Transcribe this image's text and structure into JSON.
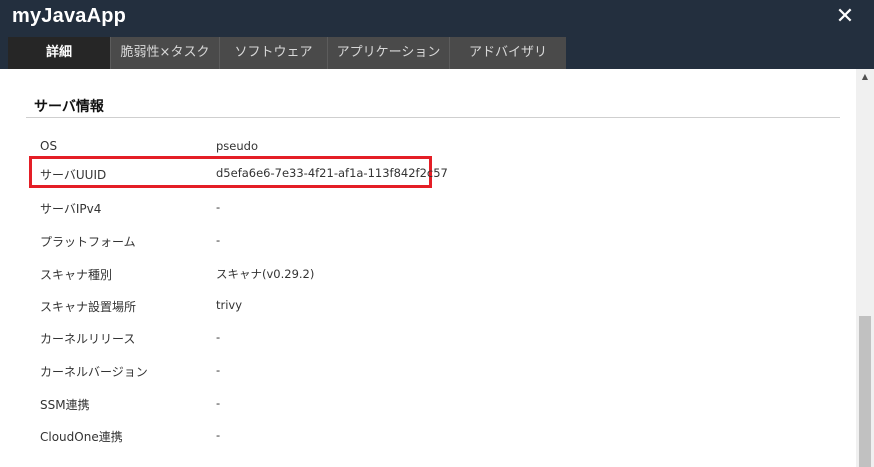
{
  "window": {
    "title": "myJavaApp",
    "close_glyph": "✕"
  },
  "tabs": [
    {
      "label": "詳細",
      "active": true
    },
    {
      "label": "脆弱性×タスク",
      "active": false
    },
    {
      "label": "ソフトウェア",
      "active": false
    },
    {
      "label": "アプリケーション",
      "active": false
    },
    {
      "label": "アドバイザリ",
      "active": false
    }
  ],
  "section": {
    "title": "サーバ情報"
  },
  "rows": [
    {
      "key": "OS",
      "value": "pseudo"
    },
    {
      "key": "サーバUUID",
      "value": "d5efa6e6-7e33-4f21-af1a-113f842f2c57",
      "highlighted": true
    },
    {
      "key": "サーバIPv4",
      "value": "-"
    },
    {
      "key": "プラットフォーム",
      "value": "-"
    },
    {
      "key": "スキャナ種別",
      "value": "スキャナ(v0.29.2)"
    },
    {
      "key": "スキャナ設置場所",
      "value": "trivy"
    },
    {
      "key": "カーネルリリース",
      "value": "-"
    },
    {
      "key": "カーネルバージョン",
      "value": "-"
    },
    {
      "key": "SSM連携",
      "value": "-"
    },
    {
      "key": "CloudOne連携",
      "value": "-"
    }
  ],
  "colors": {
    "titlebar": "#232f3e",
    "tab_strip": "#4a4a4a",
    "tab_active": "#262626",
    "highlight_border": "#e41e26"
  },
  "icons": {
    "close": "close-icon",
    "scroll_up": "chevron-up-icon"
  }
}
